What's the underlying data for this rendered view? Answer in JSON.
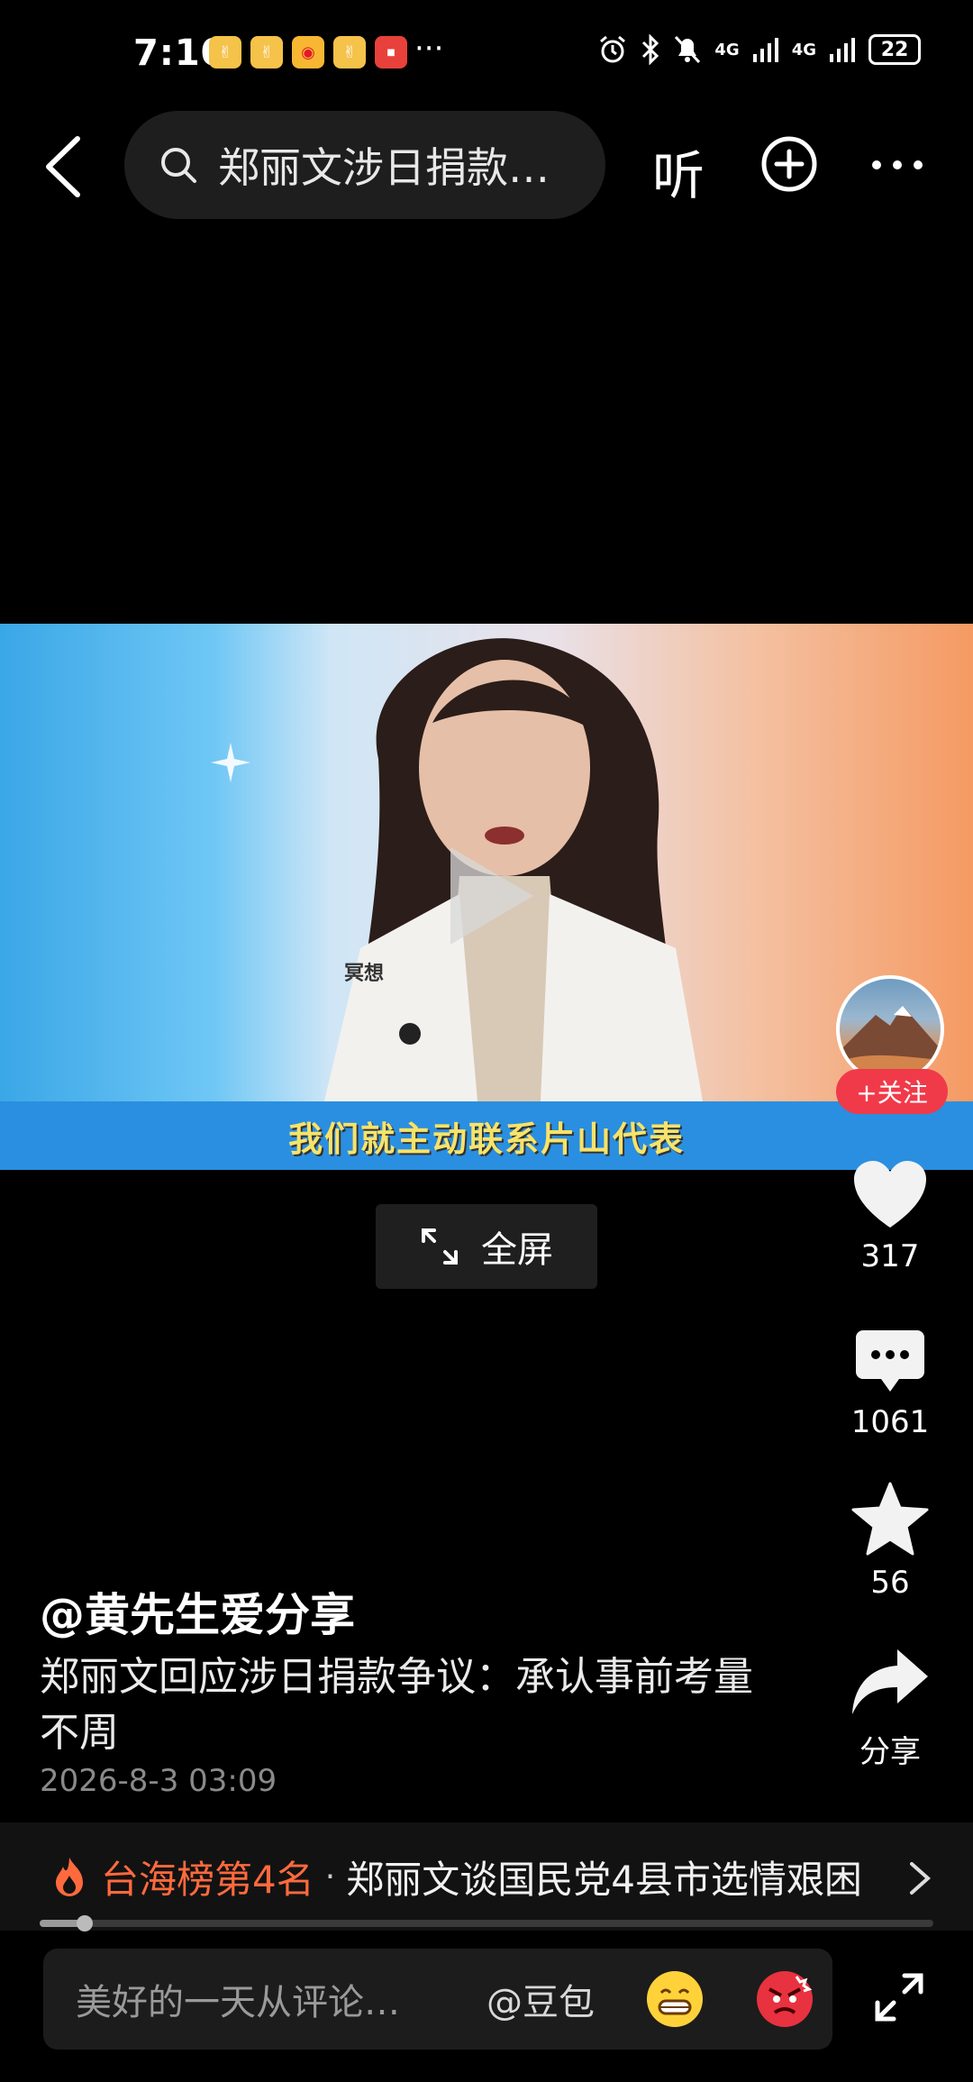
{
  "status_bar": {
    "time": "7:10",
    "more": "···",
    "network_1": "4G",
    "network_2": "4G",
    "battery": "22",
    "app_icons": [
      "vivo-app-icon",
      "vivo-app-icon",
      "weibo-icon",
      "vivo-app-icon",
      "huawei-icon"
    ]
  },
  "top_bar": {
    "search_text": "郑丽文涉日捐款…",
    "listen_label": "听"
  },
  "video": {
    "caption": "我们就主动联系片山代表",
    "corner_text": "冥想"
  },
  "fullscreen_label": "全屏",
  "right_rail": {
    "follow_label": "+关注",
    "likes": "317",
    "comments": "1061",
    "favorites": "56",
    "share_label": "分享"
  },
  "post": {
    "author": "@黄先生爱分享",
    "description": "郑丽文回应涉日捐款争议：承认事前考量不周",
    "date": "2026-8-3 03:09"
  },
  "hot_bar": {
    "rank": "台海榜第4名",
    "separator": "·",
    "title": "郑丽文谈国民党4县市选情艰困"
  },
  "progress": {
    "fraction": 0.05
  },
  "comment_bar": {
    "placeholder": "美好的一天从评论…",
    "mention": "@豆包"
  },
  "colors": {
    "accent_red": "#f03a4a",
    "hot_orange": "#ff6a3d",
    "caption_yellow": "#f6e36a"
  }
}
